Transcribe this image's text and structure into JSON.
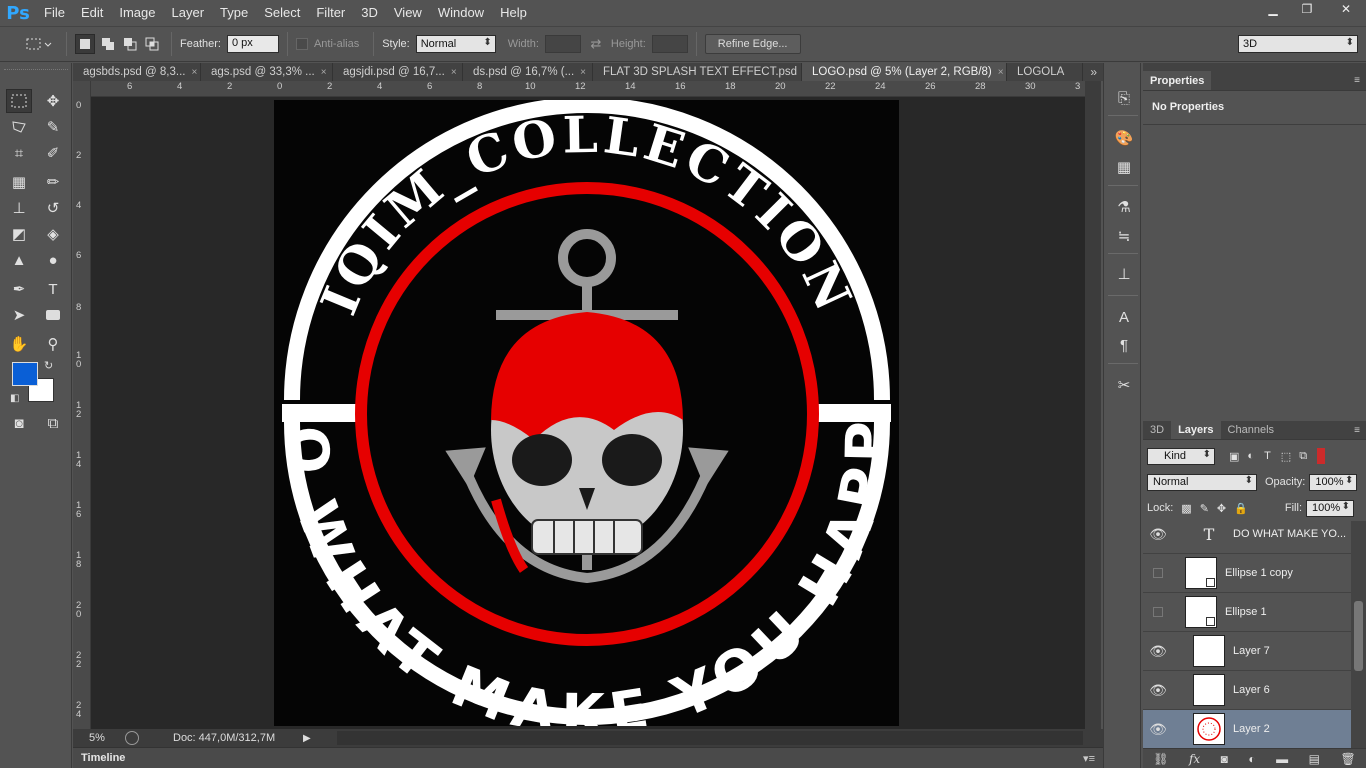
{
  "app": {
    "logo": "Ps"
  },
  "menu": [
    "File",
    "Edit",
    "Image",
    "Layer",
    "Type",
    "Select",
    "Filter",
    "3D",
    "View",
    "Window",
    "Help"
  ],
  "window_controls": {
    "minimize": "▁",
    "restore": "❐",
    "close": "✕"
  },
  "options": {
    "feather_label": "Feather:",
    "feather_value": "0 px",
    "antialias_label": "Anti-alias",
    "style_label": "Style:",
    "style_value": "Normal",
    "width_label": "Width:",
    "height_label": "Height:",
    "refine_edge": "Refine Edge...",
    "workspace": "3D"
  },
  "tabs": [
    {
      "label": "agsbds.psd @ 8,3..."
    },
    {
      "label": "ags.psd @ 33,3% ..."
    },
    {
      "label": "agsjdi.psd @ 16,7..."
    },
    {
      "label": "ds.psd @ 16,7% (..."
    },
    {
      "label": "FLAT 3D SPLASH TEXT EFFECT.psd"
    },
    {
      "label": "LOGO.psd @ 5% (Layer 2, RGB/8)"
    },
    {
      "label": "LOGOLA"
    }
  ],
  "tab_close": "×",
  "tab_overflow": "»",
  "ruler_top": [
    "6",
    "4",
    "2",
    "0",
    "2",
    "4",
    "6",
    "8",
    "10",
    "12",
    "14",
    "16",
    "18",
    "20",
    "22",
    "24",
    "26",
    "28",
    "30",
    "3"
  ],
  "ruler_left": [
    "0",
    "2",
    "4",
    "6",
    "8",
    "1\n0",
    "1\n2",
    "1\n4",
    "1\n6",
    "1\n8",
    "2\n0",
    "2\n2",
    "2\n4"
  ],
  "logo": {
    "top_text": "IQIM_COLLECTION",
    "bottom_text": "DO WHAT MAKE YOU HAPPY"
  },
  "status": {
    "zoom": "5%",
    "doc": "Doc: 447,0M/312,7M"
  },
  "timeline": {
    "label": "Timeline"
  },
  "colors": {
    "foreground": "#0a5fd6",
    "background": "#ffffff",
    "accent_red": "#e60000",
    "selected_layer": "#6f7f94"
  },
  "properties": {
    "tab": "Properties",
    "body": "No Properties"
  },
  "layers_panel": {
    "tabs": [
      "3D",
      "Layers",
      "Channels"
    ],
    "filter": "Kind",
    "blend_mode": "Normal",
    "opacity_label": "Opacity:",
    "opacity_value": "100%",
    "lock_label": "Lock:",
    "fill_label": "Fill:",
    "fill_value": "100%",
    "layers": [
      {
        "name": "DO WHAT MAKE YO...",
        "type": "text",
        "visible": true,
        "selected": false
      },
      {
        "name": "Ellipse 1 copy",
        "type": "shape",
        "visible": false,
        "selected": false
      },
      {
        "name": "Ellipse 1",
        "type": "shape",
        "visible": false,
        "selected": false
      },
      {
        "name": "Layer 7",
        "type": "pixel",
        "visible": true,
        "selected": false
      },
      {
        "name": "Layer 6",
        "type": "pixel",
        "visible": true,
        "selected": false
      },
      {
        "name": "Layer 2",
        "type": "pixel",
        "visible": true,
        "selected": true
      }
    ]
  },
  "icons": {
    "eye": "eye-icon",
    "text_layer": "T",
    "link": "link-icon",
    "fx": "fx",
    "mask": "mask-icon",
    "adjust": "adjustment-icon",
    "group": "folder-icon",
    "new": "new-layer-icon",
    "trash": "trash-icon"
  }
}
